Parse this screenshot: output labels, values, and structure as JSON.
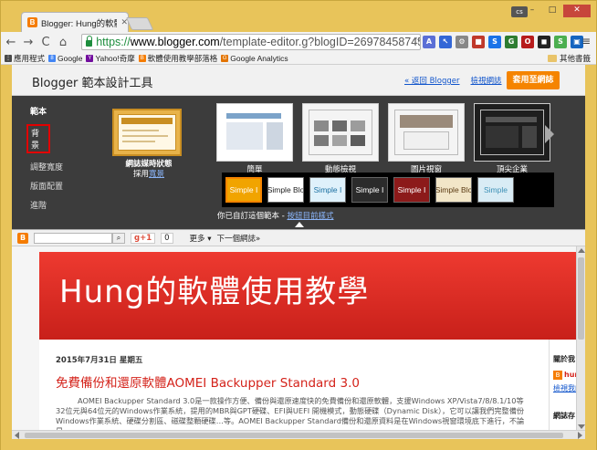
{
  "browser": {
    "tab_title": "Blogger: Hung的軟體使用",
    "tab_close": "✕",
    "user_badge": "cs",
    "url_scheme": "https://",
    "url_domain": "www.blogger.com",
    "url_path": "/template-editor.g?blogID=2697845874563654",
    "window_min": "–",
    "window_max": "□",
    "window_close": "✕",
    "back_icon": "←",
    "forward_icon": "→",
    "reload_icon": "C",
    "home_icon": "⌂",
    "star_icon": "☆",
    "menu_icon": "≡"
  },
  "bookmarks": {
    "items": [
      {
        "label": "應用程式",
        "icon_color": "#4a4a4a"
      },
      {
        "label": "Google",
        "icon_color": "#4285f4",
        "glyph": "8"
      },
      {
        "label": "Yahoo!奇摩",
        "icon_color": "#720e9e",
        "glyph": "Y"
      },
      {
        "label": "軟體使用教學部落格",
        "icon_color": "#f57c00",
        "glyph": "B"
      },
      {
        "label": "Google Analytics",
        "icon_color": "#e37400",
        "glyph": "G"
      }
    ],
    "other": "其他書籤"
  },
  "designer": {
    "title": "Blogger 範本設計工具",
    "links": [
      "« 返回 Blogger",
      "檢視網誌",
      "說明"
    ],
    "apply_button": "套用至網誌",
    "menu_heading": "範本",
    "menu_items": [
      "背景",
      "調整寬度",
      "版面配置",
      "進階"
    ],
    "current_template_name": "網誌媒時狀態",
    "current_template_caption_prefix": "採用",
    "current_template_caption_link": "寬景",
    "templates": [
      {
        "label": "簡單",
        "selected": true
      },
      {
        "label": "動態檢視",
        "selected": false
      },
      {
        "label": "圖片視窗",
        "selected": false
      },
      {
        "label": "頂尖企業",
        "selected": false
      }
    ],
    "variants": [
      {
        "label": "Simple I",
        "bg": "#f1a400",
        "fg": "#ffffff",
        "selected": true
      },
      {
        "label": "Simple Blo",
        "bg": "#ffffff",
        "fg": "#222222",
        "selected": false
      },
      {
        "label": "Simple I",
        "bg": "#dff1fb",
        "fg": "#1a6fa0",
        "selected": false
      },
      {
        "label": "Simple I",
        "bg": "#2b2b2b",
        "fg": "#ffffff",
        "selected": false
      },
      {
        "label": "Simple I",
        "bg": "#8c1a1a",
        "fg": "#ffffff",
        "selected": false
      },
      {
        "label": "Simple Blo",
        "bg": "#f2e6c8",
        "fg": "#5a3a12",
        "selected": false
      },
      {
        "label": "Simple",
        "bg": "#d9ecf5",
        "fg": "#3b8fb5",
        "selected": false
      }
    ],
    "variants_caption_prefix": "你已自訂這個範本 - ",
    "variants_caption_link": "按鈕目前樣式"
  },
  "preview": {
    "navbar": {
      "gplus": "g+1",
      "gplus_count": "0",
      "more": "更多 ▾",
      "next_blog": "下一個網誌»"
    },
    "blog_title": "Hung的軟體使用教學",
    "post_date": "2015年7月31日 星期五",
    "post_title": "免費備份和還原軟體AOMEI Backupper Standard 3.0",
    "post_body": "AOMEI Backupper Standard 3.0是一款操作方便、備份與還原速度快的免費備份和還原軟體，支援Windows XP/Vista7/8/8.1/10等32位元與64位元的Windows作業系統，提用的MBR與GPT硬碟、EFI與UEFI 開機模式，動態硬碟（Dynamic Disk），它可以讓我們完整備份Windows作業系統、硬碟分割區、磁碟整顆硬碟…等。AOMEI Backupper Standard備份和還原資料是在Windows視窗環境底下進行，不論是",
    "sidebar_about": "關於我",
    "sidebar_name": "hun",
    "sidebar_profile": "檢視我的",
    "sidebar_archive": "網誌存"
  }
}
